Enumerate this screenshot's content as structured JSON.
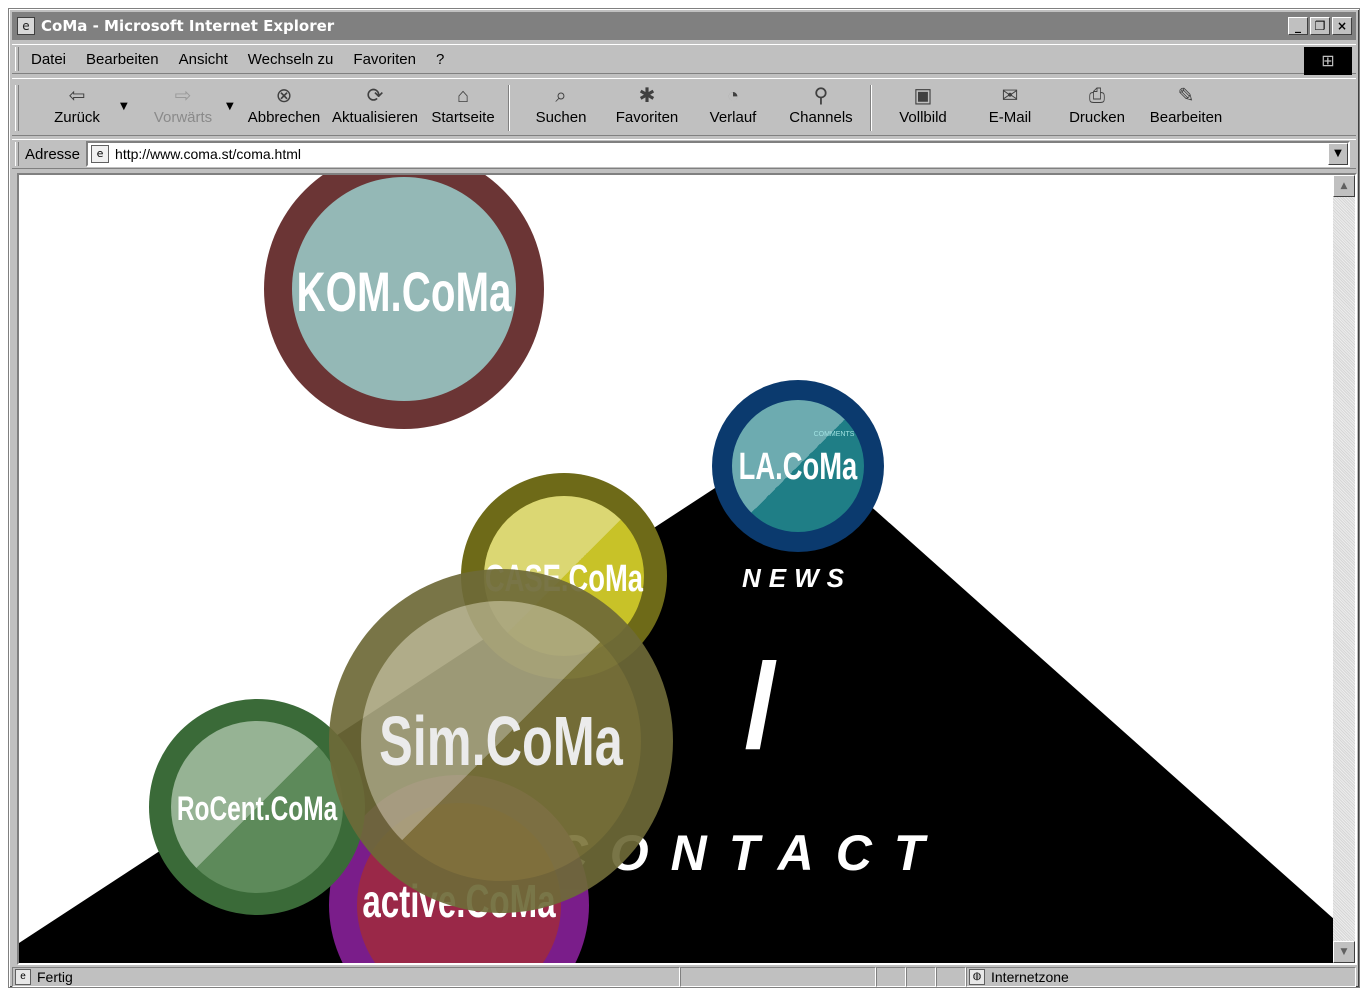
{
  "window": {
    "title": "CoMa - Microsoft Internet Explorer",
    "buttons": [
      "_",
      "❐",
      "×"
    ]
  },
  "menu": {
    "items": [
      "Datei",
      "Bearbeiten",
      "Ansicht",
      "Wechseln zu",
      "Favoriten",
      "?"
    ]
  },
  "toolbar": {
    "back": "Zurück",
    "forward": "Vorwärts",
    "stop": "Abbrechen",
    "refresh": "Aktualisieren",
    "home": "Startseite",
    "search": "Suchen",
    "favorites": "Favoriten",
    "history": "Verlauf",
    "channels": "Channels",
    "fullscreen": "Vollbild",
    "mail": "E-Mail",
    "print": "Drucken",
    "edit": "Bearbeiten"
  },
  "address": {
    "label": "Adresse",
    "url": "http://www.coma.st/coma.html"
  },
  "page": {
    "bubbles": {
      "kom": "KOM.CoMa",
      "la": "LA.CoMa",
      "la_small": "COMMENTS",
      "sim": "Sim.CoMa",
      "rocent": "RoCent.CoMa",
      "active": "active.CoMa",
      "yellow": "CASE.CoMa"
    },
    "news": "NEWS",
    "slash": "/",
    "contact": "CONTACT"
  },
  "status": {
    "text": "Fertig",
    "zone": "Internetzone"
  },
  "colors": {
    "titlebar": "#808080",
    "chrome": "#c0c0c0",
    "kom_ring": "#6b3535",
    "kom_fill": "#94b8b6",
    "la_ring": "#0b3a6e",
    "la_fill": "#1f7e86",
    "sim": "#6e6a38",
    "rocent_ring": "#3a6a38",
    "active_ring": "#7a1d8a"
  }
}
